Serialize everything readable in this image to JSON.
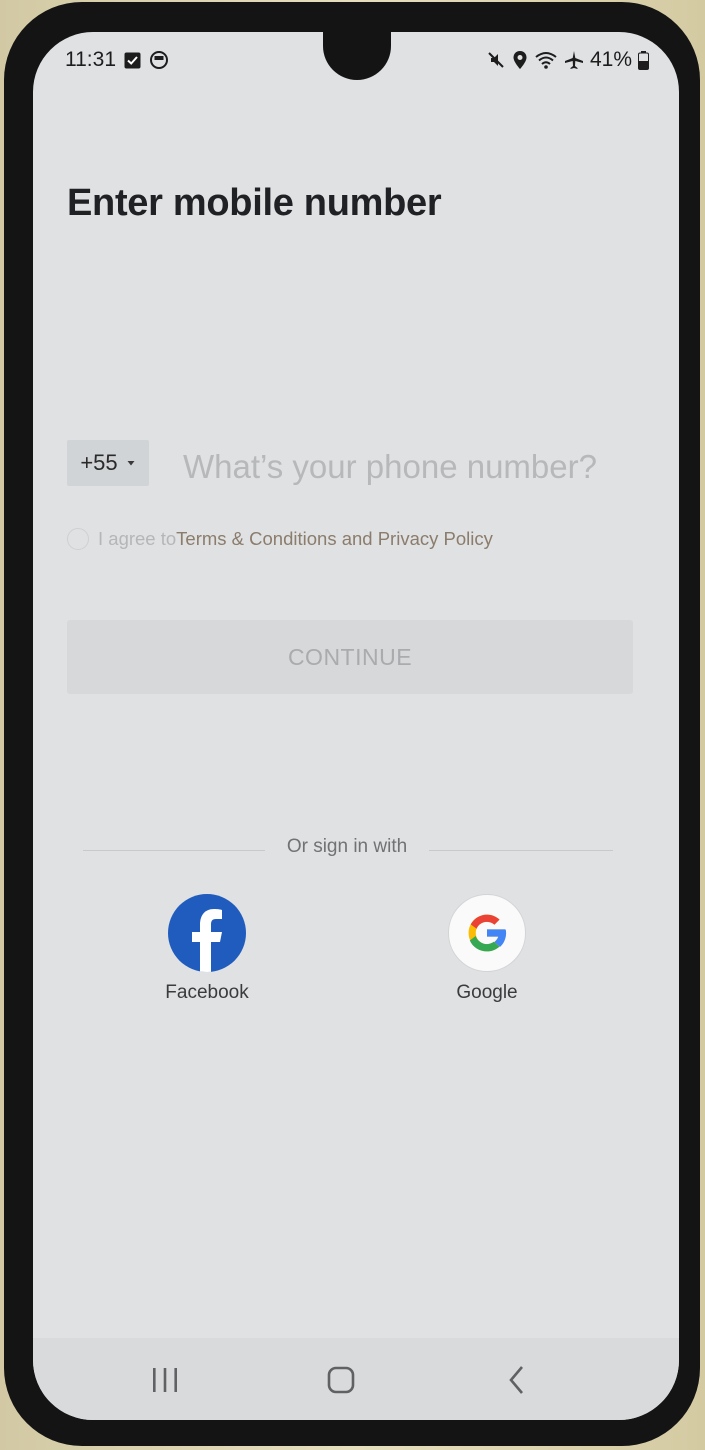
{
  "status_bar": {
    "time": "11:31",
    "battery": "41%",
    "icons": [
      "check-square-icon",
      "chat-bubble-icon",
      "mute-icon",
      "location-icon",
      "wifi-icon",
      "airplane-icon",
      "battery-icon"
    ]
  },
  "page": {
    "title": "Enter mobile number"
  },
  "phone_form": {
    "country_code": "+55",
    "phone_placeholder": "What’s your phone number?",
    "agree_prefix": "I agree to",
    "agree_link": "Terms & Conditions and Privacy Policy",
    "continue_label": "CONTINUE"
  },
  "social": {
    "divider_text": "Or sign in with",
    "facebook_label": "Facebook",
    "google_label": "Google"
  },
  "colors": {
    "facebook_blue": "#1f5cbd",
    "google_blue": "#4285F4",
    "google_red": "#EA4335",
    "google_yellow": "#FBBC05",
    "google_green": "#34A853"
  },
  "nav_bar": {
    "icons": [
      "recent-apps-icon",
      "home-icon",
      "back-icon"
    ]
  }
}
